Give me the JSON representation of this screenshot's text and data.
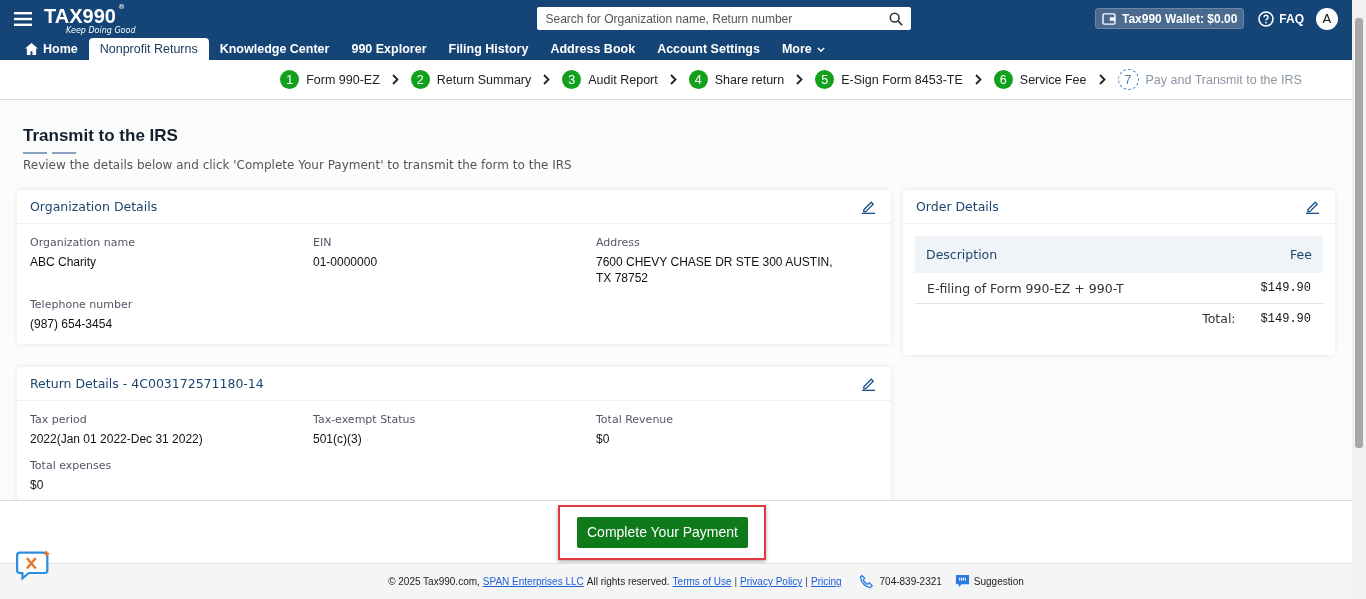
{
  "header": {
    "logo": "TAX990",
    "logo_mark": "®",
    "tagline": "Keep Doing Good",
    "search": {
      "placeholder": "Search for Organization name, Return number"
    },
    "wallet": "Tax990 Wallet: $0.00",
    "faq": "FAQ",
    "avatar": "A"
  },
  "nav_tabs": [
    {
      "label": "Home",
      "kind": "home",
      "selected": false
    },
    {
      "label": "Nonprofit Returns",
      "selected": true
    },
    {
      "label": "Knowledge Center",
      "selected": false
    },
    {
      "label": "990 Explorer",
      "selected": false
    },
    {
      "label": "Filing History",
      "selected": false
    },
    {
      "label": "Address Book",
      "selected": false
    },
    {
      "label": "Account Settings",
      "selected": false
    },
    {
      "label": "More",
      "kind": "menu",
      "selected": false
    }
  ],
  "steps": [
    {
      "number": "1",
      "label": "Form 990-EZ",
      "done": true
    },
    {
      "number": "2",
      "label": "Return Summary",
      "done": true
    },
    {
      "number": "3",
      "label": "Audit Report",
      "done": true
    },
    {
      "number": "4",
      "label": "Share return",
      "done": true
    },
    {
      "number": "5",
      "label": "E-Sign Form 8453-TE",
      "done": true
    },
    {
      "number": "6",
      "label": "Service Fee",
      "done": true
    },
    {
      "number": "7",
      "label": "Pay and Transmit to the IRS",
      "done": false
    }
  ],
  "page": {
    "title": "Transmit to the IRS",
    "subtitle": "Review the details below and click 'Complete Your Payment' to transmit the form to the IRS"
  },
  "organization_details": {
    "title": "Organization Details",
    "fields": [
      {
        "label": "Organization name",
        "value": "ABC Charity"
      },
      {
        "label": "EIN",
        "value": "01-0000000"
      },
      {
        "label": "Address",
        "value": "7600 CHEVY CHASE DR STE 300 AUSTIN, TX 78752"
      },
      {
        "label": "Telephone number",
        "value": "(987) 654-3454"
      }
    ]
  },
  "return_details": {
    "title": "Return Details - 4C003172571180-14",
    "fields": [
      {
        "label": "Tax period",
        "value": "2022(Jan 01 2022-Dec 31 2022)"
      },
      {
        "label": "Tax-exempt Status",
        "value": "501(c)(3)"
      },
      {
        "label": "Total Revenue",
        "value": "$0"
      },
      {
        "label": "Total expenses",
        "value": "$0"
      }
    ]
  },
  "order_details": {
    "title": "Order Details",
    "columns": [
      "Description",
      "Fee"
    ],
    "rows": [
      {
        "description": "E-filing of Form 990-EZ + 990-T",
        "fee": "$149.90"
      }
    ],
    "total_label": "Total:",
    "total": "$149.90"
  },
  "action": {
    "button": "Complete Your Payment",
    "highlighted": true
  },
  "footer": {
    "copyright": "© 2025 Tax990.com,",
    "company": "SPAN Enterprises LLC",
    "rights": "All rights reserved.",
    "links": [
      "Terms of Use",
      "Privacy Policy",
      "Pricing"
    ],
    "separator": "|",
    "phone": "704-839-2321",
    "suggestion": "Suggestion"
  }
}
